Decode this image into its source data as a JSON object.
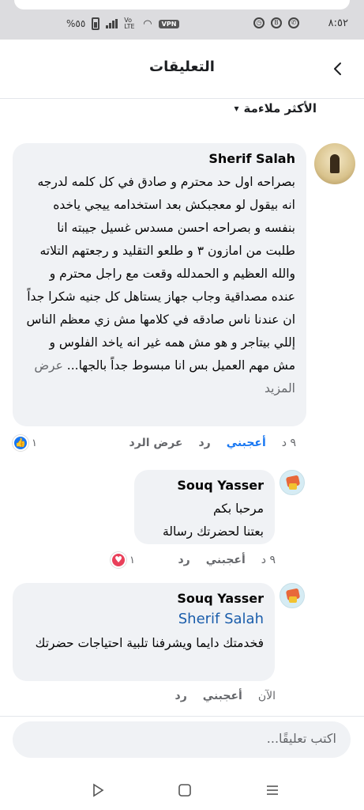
{
  "status_bar": {
    "time": "٨:٥٢",
    "battery": "%٥٥",
    "network": "Vo LTE",
    "vpn": "VPN"
  },
  "header": {
    "title": "التعليقات",
    "back_icon": "chevron-left-icon"
  },
  "sort": {
    "label": "الأكثر ملاءمة",
    "icon": "chevron-down-icon"
  },
  "comments": [
    {
      "author": "Sherif Salah",
      "text": "بصراحه اول حد محترم و صادق في كل كلمه لدرجه انه بيقول لو معجبكش بعد استخدامه ييجي ياخده بنفسه و بصراحه احسن مسدس غسيل جيبته انا طلبت من امازون ٣ و طلعو التقليد و رجعتهم التلاته والله العظيم و الحمدلله وقعت مع راجل محترم و عنده مصداقية وجاب جهاز يستاهل كل جنيه شكرا جداً ان عندنا ناس صادقه في كلامها مش زي معظم الناس إللي بيتاجر و هو مش همه غير انه ياخد الفلوس و مش مهم العميل بس انا مبسوط جداً بالجها...",
      "see_more": "عرض المزيد",
      "time": "٩ د",
      "like": "أعجبني",
      "reply": "رد",
      "view_replies": "عرض الرد",
      "reaction_count": "١",
      "reaction": "like"
    },
    {
      "author": "Souq Yasser",
      "line1": "مرحبا بكم",
      "line2": "بعتنا لحضرتك رسالة",
      "time": "٩ د",
      "like": "أعجبني",
      "reply": "رد",
      "reaction_count": "١",
      "reaction": "love"
    },
    {
      "author": "Souq Yasser",
      "mention": "Sherif Salah",
      "text": "فخدمتك دايما ويشرفنا تلبية احتياجات حضرتك",
      "time": "الآن",
      "like": "أعجبني",
      "reply": "رد"
    }
  ],
  "composer": {
    "placeholder": "اكتب تعليقًا..."
  },
  "colors": {
    "accent": "#1877f2",
    "bubble": "#f0f2f5",
    "love": "#e9405a"
  }
}
